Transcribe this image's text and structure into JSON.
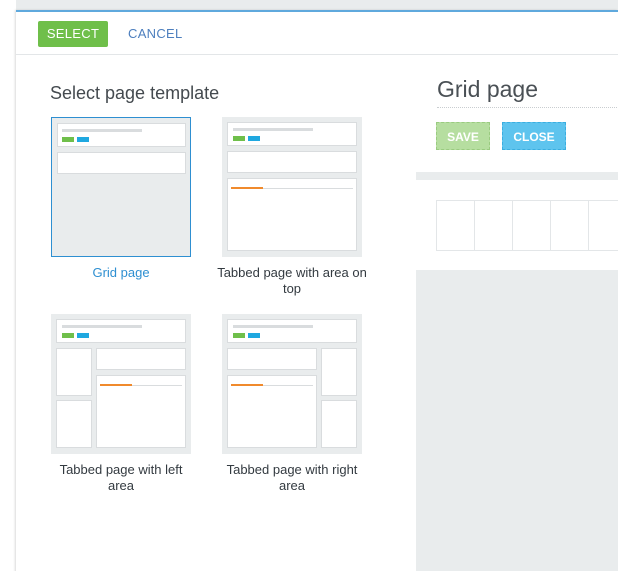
{
  "toolbar": {
    "select_label": "SELECT",
    "cancel_label": "CANCEL"
  },
  "picker": {
    "title": "Select page template",
    "templates": [
      {
        "label": "Grid page",
        "selected": true
      },
      {
        "label": "Tabbed page with area on top",
        "selected": false
      },
      {
        "label": "Tabbed page with left area",
        "selected": false
      },
      {
        "label": "Tabbed page with right area",
        "selected": false
      }
    ]
  },
  "preview": {
    "title": "Grid page",
    "save_label": "SAVE",
    "close_label": "CLOSE"
  },
  "colors": {
    "accent_green": "#6fbf4a",
    "accent_blue": "#1fa8e0",
    "selected_blue": "#2e8fd1",
    "tab_orange": "#f08a2c"
  }
}
